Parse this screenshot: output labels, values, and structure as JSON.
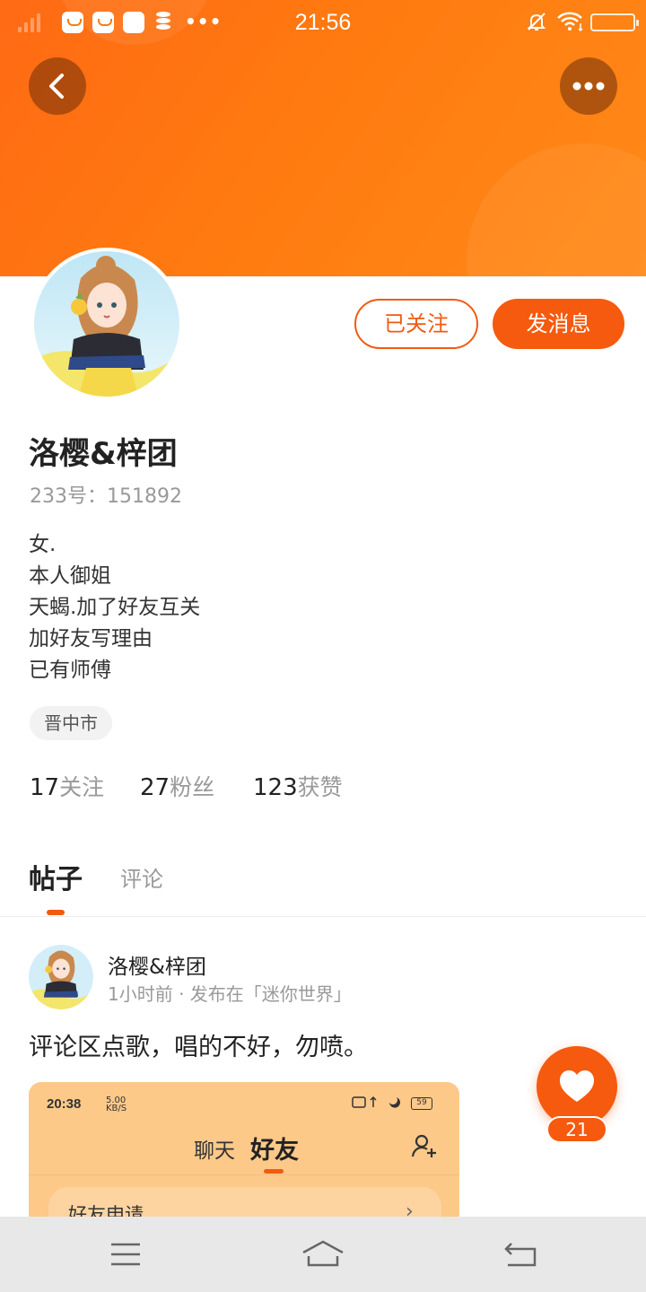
{
  "status_bar": {
    "time": "21:56",
    "more_dots": "•••"
  },
  "header": {
    "back_icon": "chevron-left-icon",
    "more_icon": "more-dots-icon"
  },
  "profile": {
    "name": "洛樱&梓团",
    "id_label": "233号：151892",
    "bio": [
      "女.",
      "本人御姐",
      "天蝎.加了好友互关",
      "加好友写理由",
      "已有师傅"
    ],
    "location": "晋中市",
    "follow_button": "已关注",
    "message_button": "发消息",
    "stats": [
      {
        "value": "17",
        "label": "关注"
      },
      {
        "value": "27",
        "label": "粉丝"
      },
      {
        "value": "123",
        "label": "获赞"
      }
    ]
  },
  "tabs": {
    "active": "帖子",
    "inactive": "评论"
  },
  "post": {
    "author": "洛樱&梓团",
    "meta": "1小时前 · 发布在「迷你世界」",
    "text": "评论区点歌，唱的不好，勿喷。",
    "embedded_screenshot": {
      "time": "20:38",
      "speed": "5.00",
      "speed_unit": "KB/S",
      "battery": "59",
      "tab_chat": "聊天",
      "tab_friends": "好友",
      "row_label": "好友申请",
      "row_arrow": "›"
    }
  },
  "like": {
    "count": "21",
    "accent_color": "#f55a0e"
  },
  "colors": {
    "brand": "#ff7a10",
    "accent": "#f25a12"
  }
}
